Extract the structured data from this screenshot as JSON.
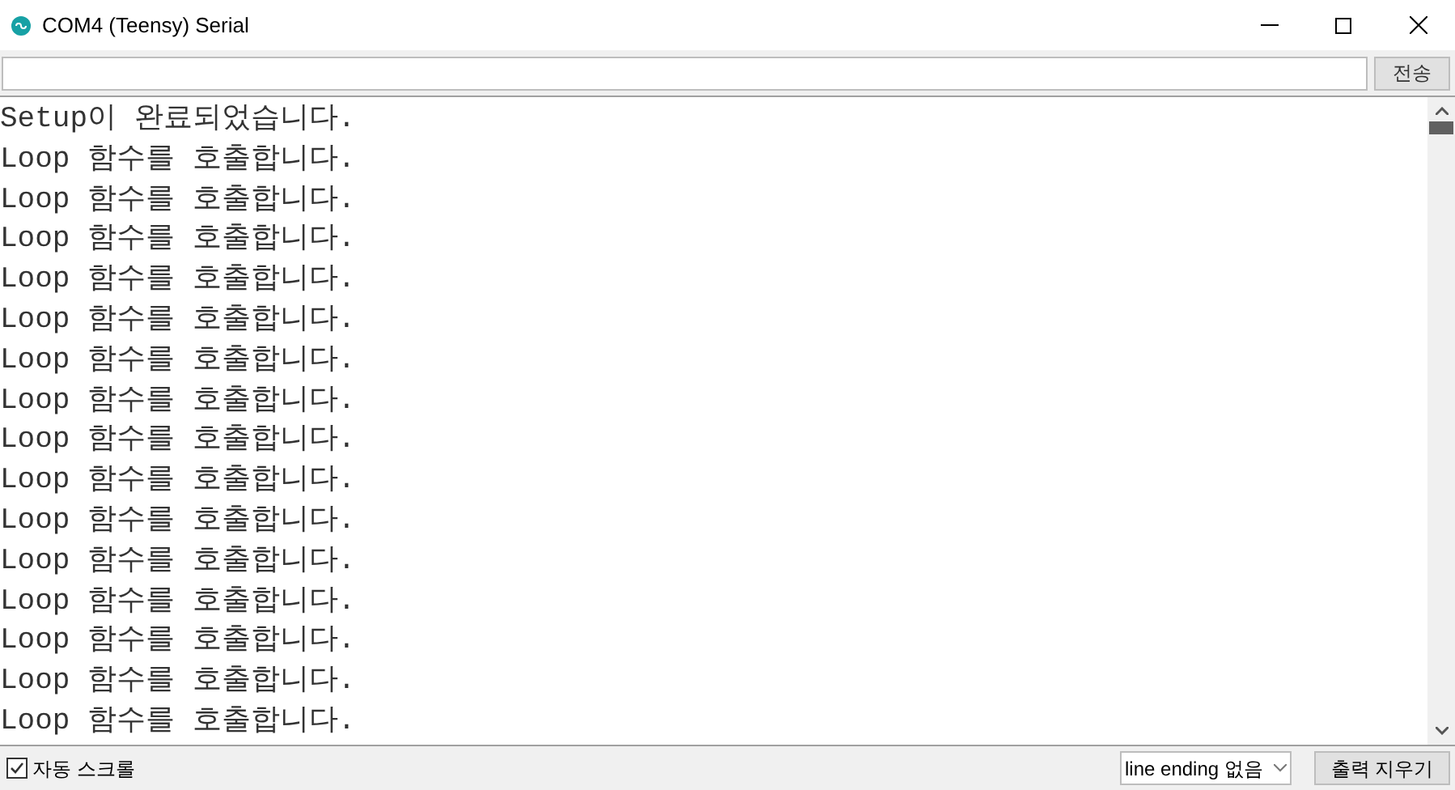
{
  "window": {
    "title": "COM4 (Teensy) Serial"
  },
  "send": {
    "button": "전송"
  },
  "output": {
    "lines": [
      "Setup이 완료되었습니다.",
      "Loop 함수를 호출합니다.",
      "Loop 함수를 호출합니다.",
      "Loop 함수를 호출합니다.",
      "Loop 함수를 호출합니다.",
      "Loop 함수를 호출합니다.",
      "Loop 함수를 호출합니다.",
      "Loop 함수를 호출합니다.",
      "Loop 함수를 호출합니다.",
      "Loop 함수를 호출합니다.",
      "Loop 함수를 호출합니다.",
      "Loop 함수를 호출합니다.",
      "Loop 함수를 호출합니다.",
      "Loop 함수를 호출합니다.",
      "Loop 함수를 호출합니다.",
      "Loop 함수를 호출합니다."
    ]
  },
  "status_bar": {
    "autoscroll": {
      "label": "자동 스크롤",
      "checked": true
    },
    "line_ending": "line ending 없음",
    "clear_button": "출력 지우기"
  }
}
